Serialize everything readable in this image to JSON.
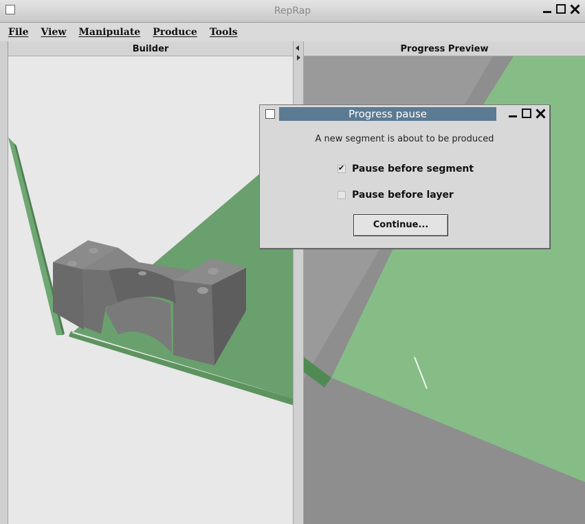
{
  "window": {
    "title": "RepRap"
  },
  "menu": {
    "items": [
      "File",
      "View",
      "Manipulate",
      "Produce",
      "Tools"
    ]
  },
  "panels": {
    "builder": {
      "title": "Builder"
    },
    "preview": {
      "title": "Progress Preview"
    }
  },
  "dialog": {
    "title": "Progress pause",
    "message": "A new segment is about to be produced",
    "checkboxes": [
      {
        "label": "Pause before segment",
        "checked": true
      },
      {
        "label": "Pause before layer",
        "checked": false
      }
    ],
    "button_label": "Continue..."
  },
  "colors": {
    "build_plate_green": "#6aa06e",
    "preview_green": "#86bd87",
    "part_gray": "#6f6f6f",
    "dialog_title_bg": "#5c7a92"
  }
}
